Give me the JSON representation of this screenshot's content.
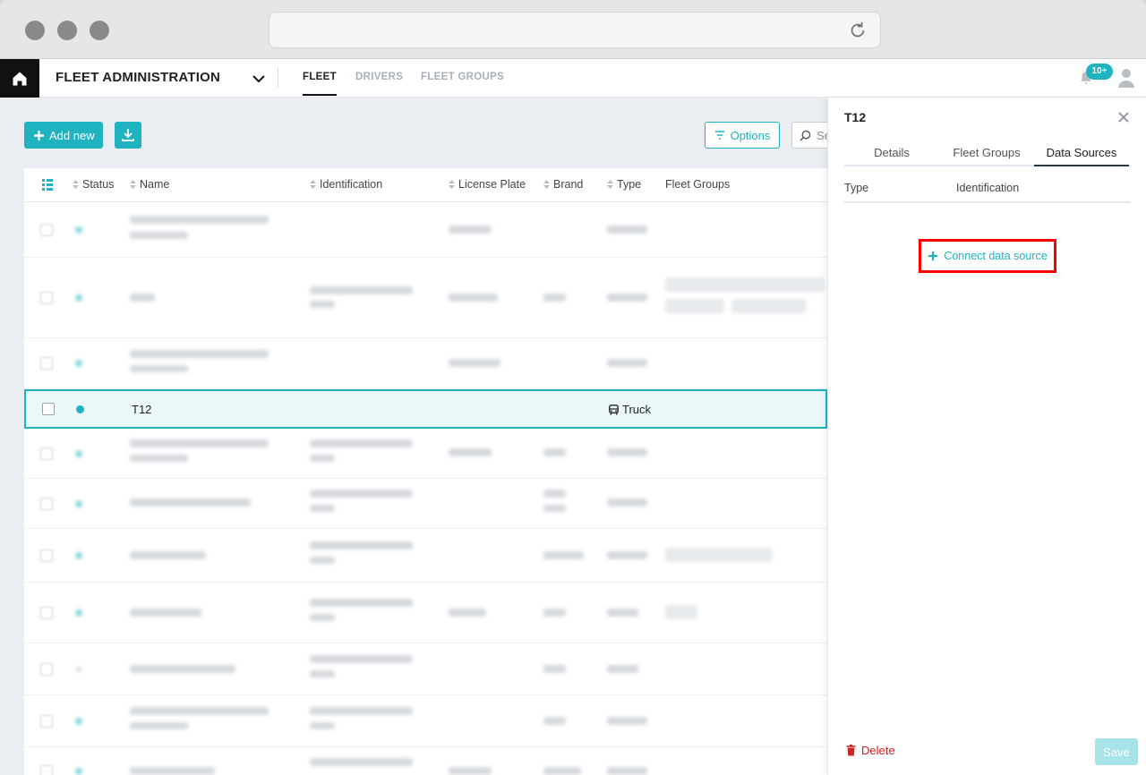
{
  "header": {
    "app_title": "FLEET ADMINISTRATION",
    "tabs": [
      {
        "label": "FLEET",
        "active": true
      },
      {
        "label": "DRIVERS",
        "active": false
      },
      {
        "label": "FLEET GROUPS",
        "active": false
      }
    ],
    "notifications_badge": "10+"
  },
  "toolbar": {
    "add_label": "Add new",
    "options_label": "Options",
    "search_placeholder": "Se"
  },
  "table": {
    "columns": [
      "Status",
      "Name",
      "Identification",
      "License Plate",
      "Brand",
      "Type",
      "Fleet Groups"
    ],
    "selected_row": {
      "name": "T12",
      "type": "Truck"
    }
  },
  "panel": {
    "title": "T12",
    "tabs": [
      {
        "label": "Details",
        "active": false
      },
      {
        "label": "Fleet Groups",
        "active": false
      },
      {
        "label": "Data Sources",
        "active": true
      }
    ],
    "columns": [
      "Type",
      "Identification"
    ],
    "connect_label": "Connect data source",
    "delete_label": "Delete",
    "save_label": "Save"
  },
  "colors": {
    "accent": "#1fb3c2",
    "danger": "#d61f1f",
    "highlight": "#ff0000"
  },
  "icons": [
    "home-icon",
    "chevron-down-icon",
    "bell-icon",
    "user-icon",
    "plus-icon",
    "download-icon",
    "filter-icon",
    "search-icon",
    "sort-icon",
    "list-view-icon",
    "bus-icon",
    "close-icon",
    "trash-icon",
    "reload-icon"
  ]
}
